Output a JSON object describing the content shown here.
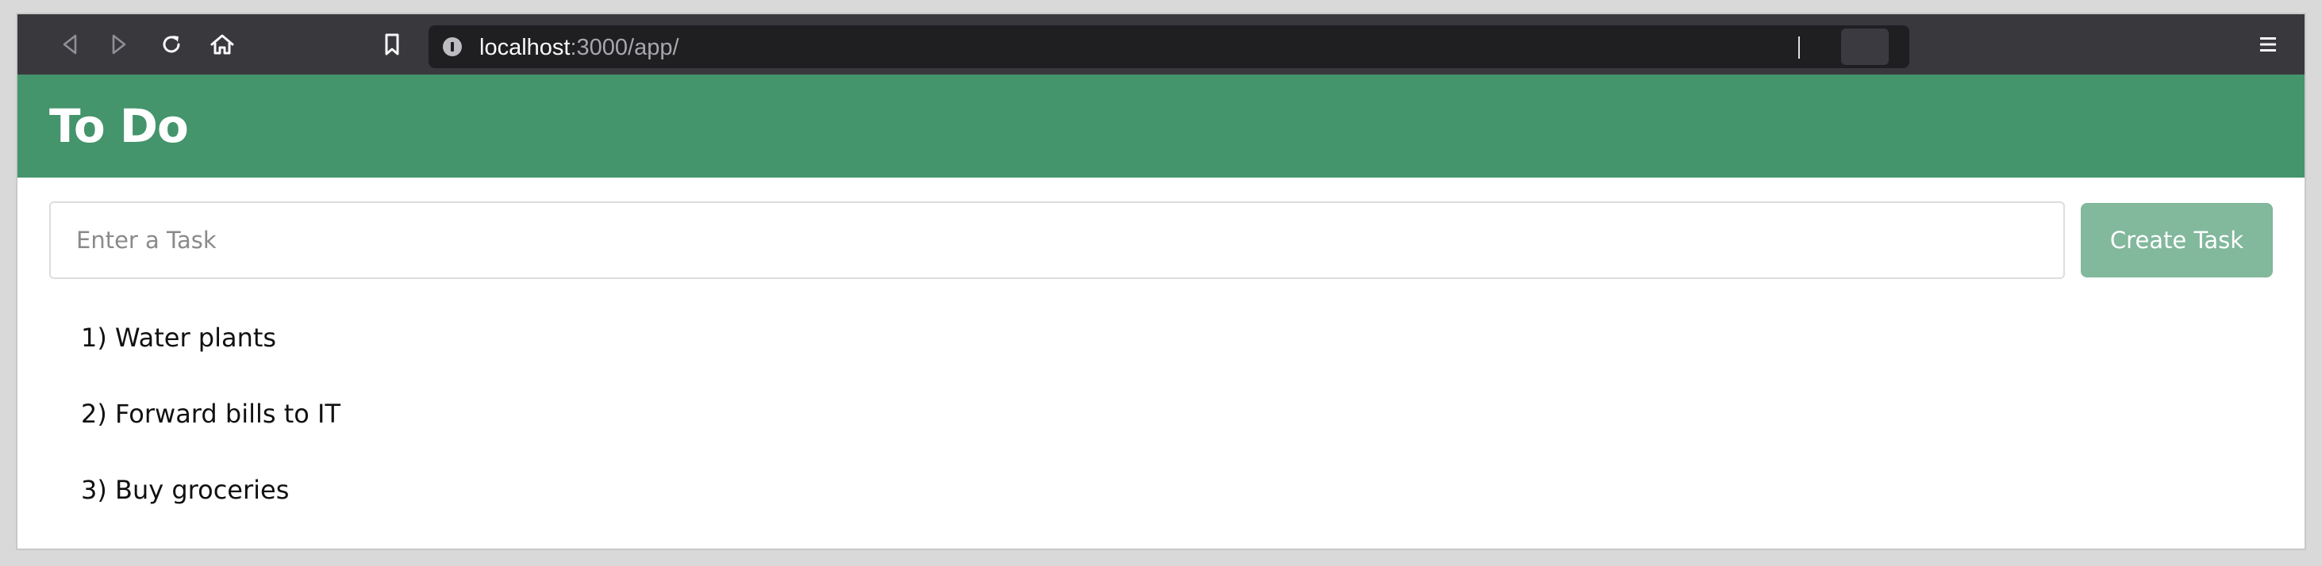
{
  "browser": {
    "url_host": "localhost",
    "url_path": ":3000/app/",
    "icons": [
      "back-icon",
      "forward-icon",
      "reload-icon",
      "home-icon",
      "bookmark-icon",
      "site-info-icon",
      "menu-icon"
    ],
    "toolbar_color": "#38383d"
  },
  "app": {
    "title": "To Do",
    "header_color": "#44946c"
  },
  "form": {
    "task_value": "",
    "placeholder": "Enter a Task",
    "create_label": "Create Task",
    "button_color": "#82b89c"
  },
  "tasks": [
    {
      "text": "1) Water plants"
    },
    {
      "text": "2) Forward bills to IT"
    },
    {
      "text": "3) Buy groceries"
    }
  ]
}
